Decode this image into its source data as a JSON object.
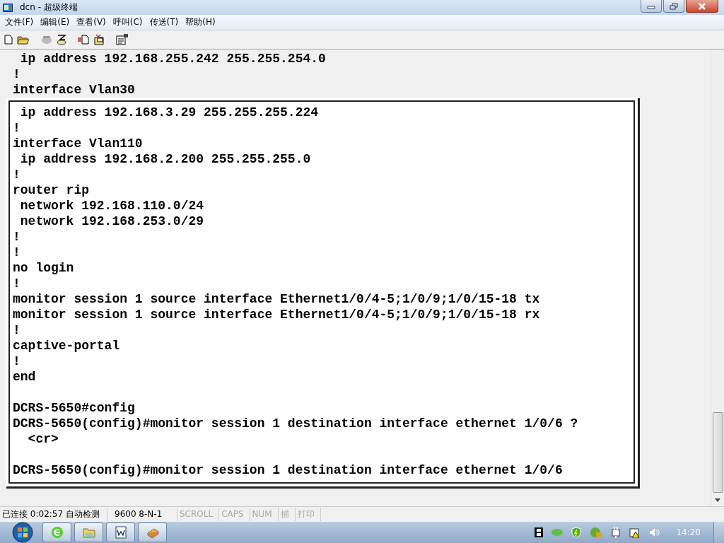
{
  "window": {
    "title": "dcn - 超级终端"
  },
  "menu": [
    {
      "label": "文件(F)"
    },
    {
      "label": "编辑(E)"
    },
    {
      "label": "查看(V)"
    },
    {
      "label": "呼叫(C)"
    },
    {
      "label": "传送(T)"
    },
    {
      "label": "帮助(H)"
    }
  ],
  "terminal": {
    "lines": [
      {
        "kind": "text",
        "text": " ip address 192.168.255.242 255.255.254.0"
      },
      {
        "kind": "text",
        "text": "!"
      },
      {
        "kind": "text",
        "text": "interface Vlan30"
      }
    ],
    "panel_lines": [
      {
        "kind": "text",
        "text": " ip address 192.168.3.29 255.255.255.224"
      },
      {
        "kind": "text",
        "text": "!"
      },
      {
        "kind": "text",
        "text": "interface Vlan110"
      },
      {
        "kind": "text",
        "text": " ip address 192.168.2.200 255.255.255.0"
      },
      {
        "kind": "text",
        "text": "!"
      },
      {
        "kind": "text",
        "text": "router rip"
      },
      {
        "kind": "text",
        "text": " network 192.168.110.0/24"
      },
      {
        "kind": "text",
        "text": " network 192.168.253.0/29"
      },
      {
        "kind": "text",
        "text": "!"
      },
      {
        "kind": "text",
        "text": "!"
      },
      {
        "kind": "text",
        "text": "no login"
      },
      {
        "kind": "text",
        "text": "!"
      },
      {
        "kind": "text",
        "text": "monitor session 1 source interface Ethernet1/0/4-5;1/0/9;1/0/15-18 tx"
      },
      {
        "kind": "text",
        "text": "monitor session 1 source interface Ethernet1/0/4-5;1/0/9;1/0/15-18 rx"
      },
      {
        "kind": "text",
        "text": "!"
      },
      {
        "kind": "text",
        "text": "captive-portal"
      },
      {
        "kind": "text",
        "text": "!"
      },
      {
        "kind": "text",
        "text": "end"
      },
      {
        "kind": "blank"
      },
      {
        "kind": "text",
        "text": "DCRS-5650#config"
      },
      {
        "kind": "text",
        "text": "DCRS-5650(config)#monitor session 1 destination interface ethernet 1/0/6 ?"
      },
      {
        "kind": "text",
        "text": "  <cr>"
      },
      {
        "kind": "blank"
      },
      {
        "kind": "text",
        "text": "DCRS-5650(config)#monitor session 1 destination interface ethernet 1/0/6"
      }
    ]
  },
  "status_bar": [
    {
      "text": "已连接 0:02:57 自动检测",
      "disabled": false
    },
    {
      "text": "9600 8-N-1",
      "disabled": false
    },
    {
      "text": "SCROLL",
      "disabled": true
    },
    {
      "text": "CAPS",
      "disabled": true
    },
    {
      "text": "NUM",
      "disabled": true
    },
    {
      "text": "捕",
      "disabled": true
    },
    {
      "text": "打印",
      "disabled": true
    }
  ],
  "taskbar": {
    "clock": "14:20"
  }
}
